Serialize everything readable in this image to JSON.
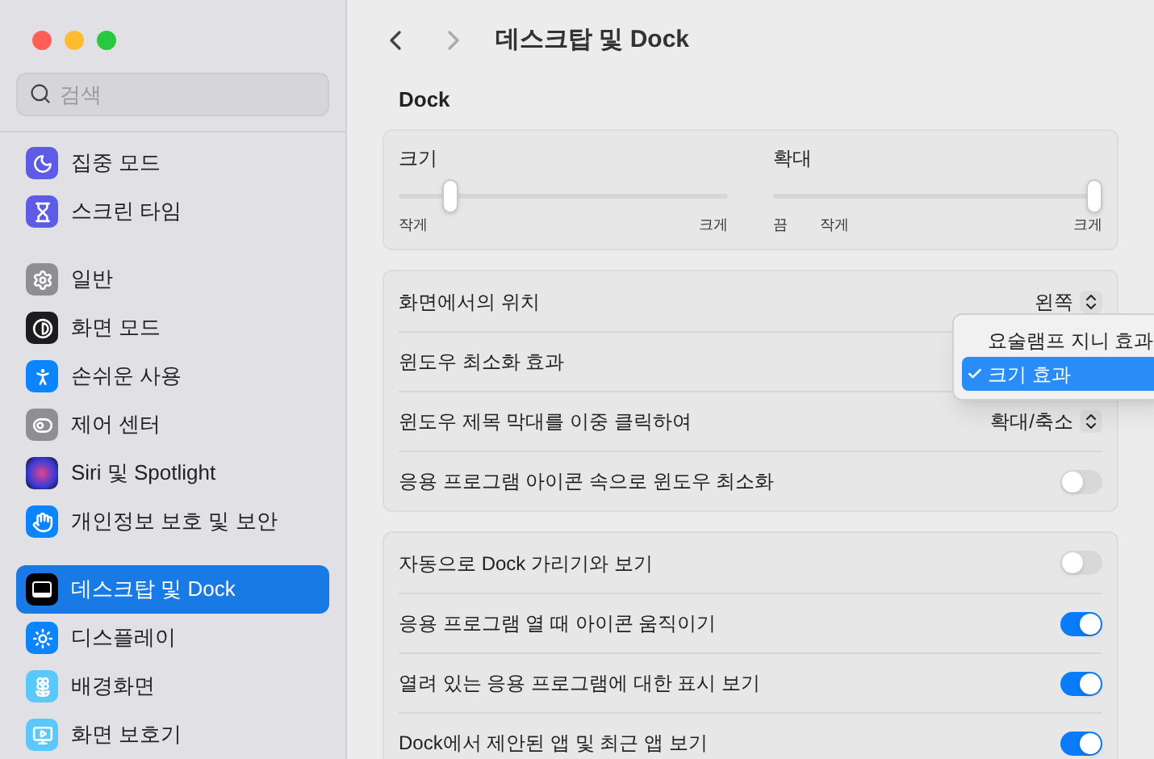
{
  "search": {
    "placeholder": "검색"
  },
  "sidebar": {
    "groups": [
      {
        "items": [
          {
            "label": "집중 모드",
            "selected": false
          },
          {
            "label": "스크린 타임",
            "selected": false
          }
        ]
      },
      {
        "items": [
          {
            "label": "일반",
            "selected": false
          },
          {
            "label": "화면 모드",
            "selected": false
          },
          {
            "label": "손쉬운 사용",
            "selected": false
          },
          {
            "label": "제어 센터",
            "selected": false
          },
          {
            "label": "Siri 및 Spotlight",
            "selected": false
          },
          {
            "label": "개인정보 보호 및 보안",
            "selected": false
          }
        ]
      },
      {
        "items": [
          {
            "label": "데스크탑 및 Dock",
            "selected": true
          },
          {
            "label": "디스플레이",
            "selected": false
          },
          {
            "label": "배경화면",
            "selected": false
          },
          {
            "label": "화면 보호기",
            "selected": false
          }
        ]
      }
    ]
  },
  "header": {
    "title": "데스크탑 및 Dock"
  },
  "section_title": "Dock",
  "sliders": [
    {
      "label": "크기",
      "level": 0.14,
      "ticks": [
        {
          "label": "작게"
        },
        {
          "label": "크게"
        }
      ]
    },
    {
      "label": "확대",
      "level": 1,
      "ticks": [
        {
          "label": "끔"
        },
        {
          "label": "작게"
        },
        {
          "label": "크게"
        }
      ]
    }
  ],
  "groups": [
    {
      "rows": [
        {
          "kind": "popup",
          "label": "화면에서의 위치",
          "value": "왼쪽"
        },
        {
          "kind": "popup",
          "label": "윈도우 최소화 효과"
        },
        {
          "kind": "popup",
          "label": "윈도우 제목 막대를 이중 클릭하여",
          "value": "확대/축소"
        },
        {
          "kind": "toggle",
          "label": "응용 프로그램 아이콘 속으로 윈도우 최소화",
          "on": false
        }
      ]
    },
    {
      "rows": [
        {
          "kind": "toggle",
          "label": "자동으로 Dock 가리기와 보기",
          "on": false
        },
        {
          "kind": "toggle",
          "label": "응용 프로그램 열 때 아이콘 움직이기",
          "on": true
        },
        {
          "kind": "toggle",
          "label": "열려 있는 응용 프로그램에 대한 표시 보기",
          "on": true
        },
        {
          "kind": "toggle",
          "label": "Dock에서 제안된 앱 및 최근 앱 보기",
          "on": true
        }
      ]
    }
  ],
  "menu": {
    "items": [
      {
        "label": "요술램프 지니 효과",
        "selected": false
      },
      {
        "label": "크기 효과",
        "selected": true
      }
    ]
  }
}
